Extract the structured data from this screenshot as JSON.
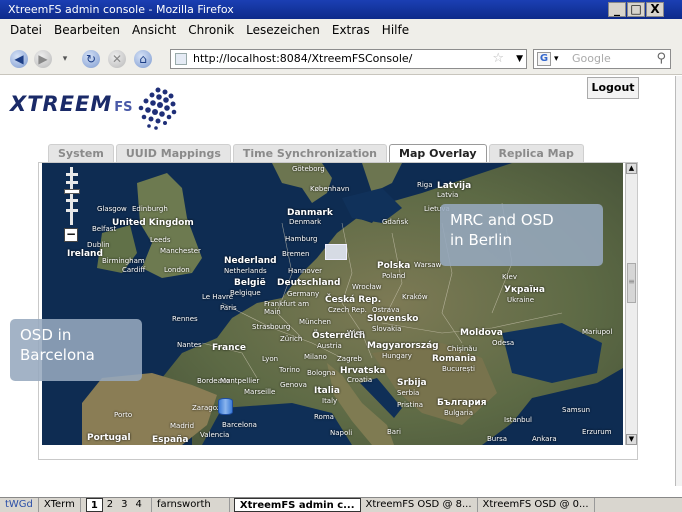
{
  "window": {
    "title": "XtreemFS admin console - Mozilla Firefox",
    "min": "_",
    "max": "□",
    "close": "X"
  },
  "menu": [
    "Datei",
    "Bearbeiten",
    "Ansicht",
    "Chronik",
    "Lesezeichen",
    "Extras",
    "Hilfe"
  ],
  "nav": {
    "url": "http://localhost:8084/XtreemFSConsole/",
    "search_placeholder": "Google"
  },
  "page": {
    "logout": "Logout",
    "logo_main": "XTREEM",
    "logo_fs": "FS",
    "tabs": [
      "System",
      "UUID Mappings",
      "Time Synchronization",
      "Map Overlay",
      "Replica Map"
    ],
    "active_tab": "Map Overlay"
  },
  "map": {
    "callout_berlin": [
      "MRC and OSD",
      "in Berlin"
    ],
    "callout_barcelona": [
      "OSD in",
      "Barcelona"
    ],
    "labels": [
      {
        "t": "Göteborg"
      },
      {
        "t": "København"
      },
      {
        "t": "Danmark"
      },
      {
        "t": "Denmark"
      },
      {
        "t": "Glasgow"
      },
      {
        "t": "Edinburgh"
      },
      {
        "t": "United Kingdom"
      },
      {
        "t": "Belfast"
      },
      {
        "t": "Dublin"
      },
      {
        "t": "Leeds"
      },
      {
        "t": "Manchester"
      },
      {
        "t": "Ireland"
      },
      {
        "t": "Birmingham"
      },
      {
        "t": "Cardiff"
      },
      {
        "t": "London"
      },
      {
        "t": "Hamburg"
      },
      {
        "t": "Bremen"
      },
      {
        "t": "Nederland"
      },
      {
        "t": "Netherlands"
      },
      {
        "t": "Hannover"
      },
      {
        "t": "België"
      },
      {
        "t": "Belgique"
      },
      {
        "t": "Deutschland"
      },
      {
        "t": "Germany"
      },
      {
        "t": "Le Havre"
      },
      {
        "t": "Paris"
      },
      {
        "t": "Frankfurt am Main"
      },
      {
        "t": "Rennes"
      },
      {
        "t": "Strasbourg"
      },
      {
        "t": "München"
      },
      {
        "t": "Nantes"
      },
      {
        "t": "France"
      },
      {
        "t": "Zürich"
      },
      {
        "t": "Lyon"
      },
      {
        "t": "Milano"
      },
      {
        "t": "Torino"
      },
      {
        "t": "Bordeaux"
      },
      {
        "t": "Montpellier"
      },
      {
        "t": "Genova"
      },
      {
        "t": "Marseille"
      },
      {
        "t": "Porto"
      },
      {
        "t": "Zaragoza"
      },
      {
        "t": "Madrid"
      },
      {
        "t": "Barcelona"
      },
      {
        "t": "Valencia"
      },
      {
        "t": "Portugal"
      },
      {
        "t": "España"
      },
      {
        "t": "Roma"
      },
      {
        "t": "Napoli"
      },
      {
        "t": "Italia"
      },
      {
        "t": "Italy"
      },
      {
        "t": "Bologna"
      },
      {
        "t": "Gdańsk"
      },
      {
        "t": "Polska"
      },
      {
        "t": "Poland"
      },
      {
        "t": "Warsaw"
      },
      {
        "t": "Wrocław"
      },
      {
        "t": "Česká Rep."
      },
      {
        "t": "Czech Rep."
      },
      {
        "t": "Ostrava"
      },
      {
        "t": "Kraków"
      },
      {
        "t": "Slovensko"
      },
      {
        "t": "Slovakia"
      },
      {
        "t": "Österreich"
      },
      {
        "t": "Austria"
      },
      {
        "t": "Wien"
      },
      {
        "t": "Magyarország"
      },
      {
        "t": "Hungary"
      },
      {
        "t": "Zagreb"
      },
      {
        "t": "Hrvatska"
      },
      {
        "t": "Croatia"
      },
      {
        "t": "Srbija"
      },
      {
        "t": "Serbia"
      },
      {
        "t": "България"
      },
      {
        "t": "Bulgaria"
      },
      {
        "t": "Pristina"
      },
      {
        "t": "Bari"
      },
      {
        "t": "Riga"
      },
      {
        "t": "Latvija"
      },
      {
        "t": "Latvia"
      },
      {
        "t": "Lietuva"
      },
      {
        "t": "Україна"
      },
      {
        "t": "Ukraine"
      },
      {
        "t": "Kiev"
      },
      {
        "t": "Moldova"
      },
      {
        "t": "Odesa"
      },
      {
        "t": "Chişinău"
      },
      {
        "t": "Romania"
      },
      {
        "t": "București"
      },
      {
        "t": "Mariupol"
      },
      {
        "t": "Samsun"
      },
      {
        "t": "Istanbul"
      },
      {
        "t": "Erzurum"
      },
      {
        "t": "Bursa"
      },
      {
        "t": "Ankara"
      }
    ]
  },
  "taskbar": {
    "left": "tWGd",
    "xterm": "XTerm",
    "pages": [
      "1",
      "2",
      "3",
      "4"
    ],
    "current_page": "1",
    "host": "farnsworth",
    "task1": "XtreemFS admin c...",
    "task2": "XtreemFS OSD @ 8...",
    "task3": "XtreemFS OSD @ 0..."
  }
}
